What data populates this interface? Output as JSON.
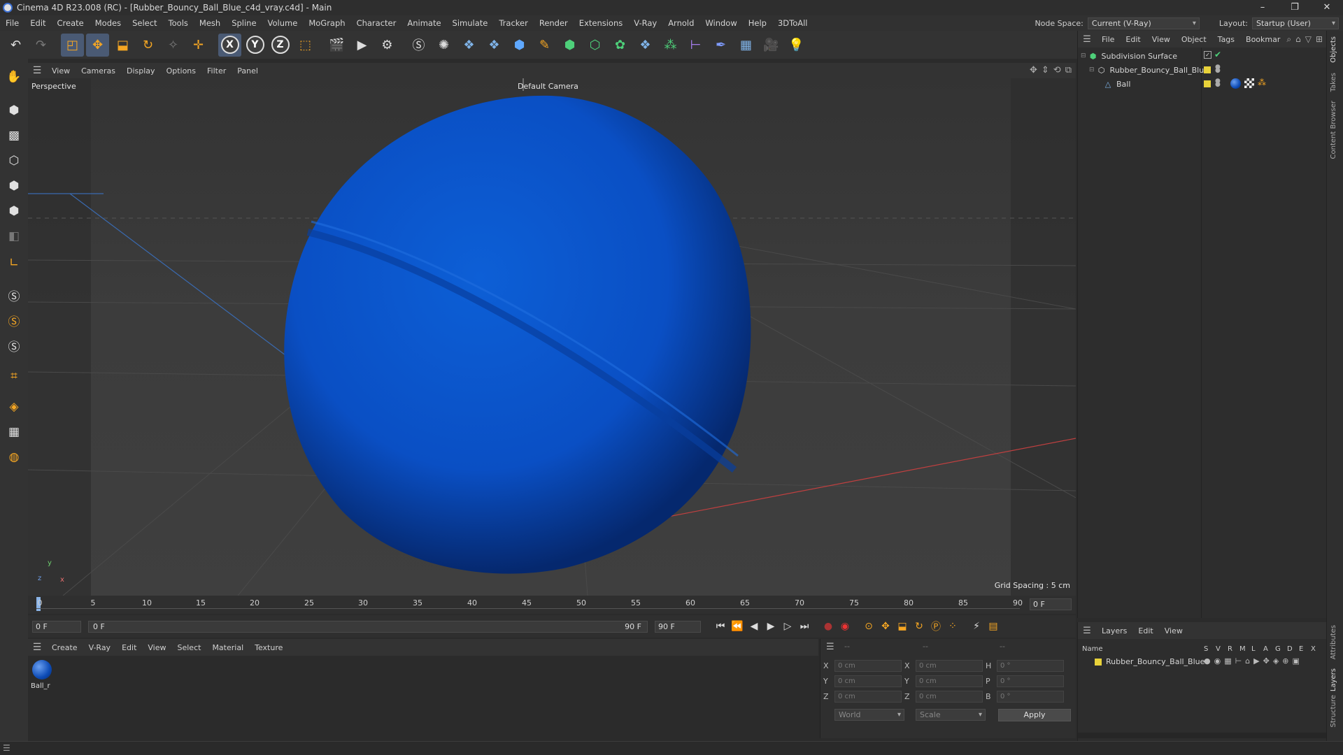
{
  "window": {
    "title": "Cinema 4D R23.008 (RC) - [Rubber_Bouncy_Ball_Blue_c4d_vray.c4d] - Main",
    "minimize": "–",
    "restore": "❐",
    "close": "✕"
  },
  "menubar": {
    "items": [
      "File",
      "Edit",
      "Create",
      "Modes",
      "Select",
      "Tools",
      "Mesh",
      "Spline",
      "Volume",
      "MoGraph",
      "Character",
      "Animate",
      "Simulate",
      "Tracker",
      "Render",
      "Extensions",
      "V-Ray",
      "Arnold",
      "Window",
      "Help",
      "3DToAll"
    ],
    "node_space_label": "Node Space:",
    "node_space_value": "Current (V-Ray)",
    "layout_label": "Layout:",
    "layout_value": "Startup (User)"
  },
  "toolbar": {
    "x_label": "X",
    "y_label": "Y",
    "z_label": "Z"
  },
  "viewport": {
    "menu": [
      "View",
      "Cameras",
      "Display",
      "Options",
      "Filter",
      "Panel"
    ],
    "label": "Perspective",
    "camera": "Default Camera",
    "grid_spacing": "Grid Spacing : 5 cm",
    "axis_y": "y",
    "axis_z": "z",
    "axis_x": "x"
  },
  "timeline": {
    "ticks": [
      "0",
      "5",
      "10",
      "15",
      "20",
      "25",
      "30",
      "35",
      "40",
      "45",
      "50",
      "55",
      "60",
      "65",
      "70",
      "75",
      "80",
      "85",
      "90"
    ],
    "current_frame": "0 F",
    "start_field": "0 F",
    "range_start": "0 F",
    "range_end": "90 F",
    "end_field": "90 F"
  },
  "material": {
    "menu": [
      "Create",
      "V-Ray",
      "Edit",
      "View",
      "Select",
      "Material",
      "Texture"
    ],
    "items": [
      {
        "name": "Ball_r"
      }
    ]
  },
  "coordinates": {
    "header": [
      "--",
      "--",
      "--"
    ],
    "rows": [
      {
        "l1": "X",
        "v1": "0 cm",
        "l2": "X",
        "v2": "0 cm",
        "l3": "H",
        "v3": "0 °"
      },
      {
        "l1": "Y",
        "v1": "0 cm",
        "l2": "Y",
        "v2": "0 cm",
        "l3": "P",
        "v3": "0 °"
      },
      {
        "l1": "Z",
        "v1": "0 cm",
        "l2": "Z",
        "v2": "0 cm",
        "l3": "B",
        "v3": "0 °"
      }
    ],
    "world": "World",
    "scale": "Scale",
    "apply": "Apply"
  },
  "objects": {
    "menu": [
      "File",
      "Edit",
      "View",
      "Object",
      "Tags",
      "Bookmar"
    ],
    "items": [
      {
        "name": "Subdivision Surface"
      },
      {
        "name": "Rubber_Bouncy_Ball_Blue"
      },
      {
        "name": "Ball"
      }
    ]
  },
  "layers": {
    "menu": [
      "Layers",
      "Edit",
      "View"
    ],
    "header_name": "Name",
    "flags": [
      "S",
      "V",
      "R",
      "M",
      "L",
      "A",
      "G",
      "D",
      "E",
      "X"
    ],
    "items": [
      {
        "name": "Rubber_Bouncy_Ball_Blue"
      }
    ]
  },
  "side_tabs": [
    "Objects",
    "Takes",
    "Content Browser",
    "Attributes",
    "Layers",
    "Structure"
  ],
  "colors": {
    "ball": "#0a4fc4",
    "layer_yellow": "#e8d23a",
    "axis_red": "#c04040",
    "axis_blue": "#3a6ab0"
  }
}
